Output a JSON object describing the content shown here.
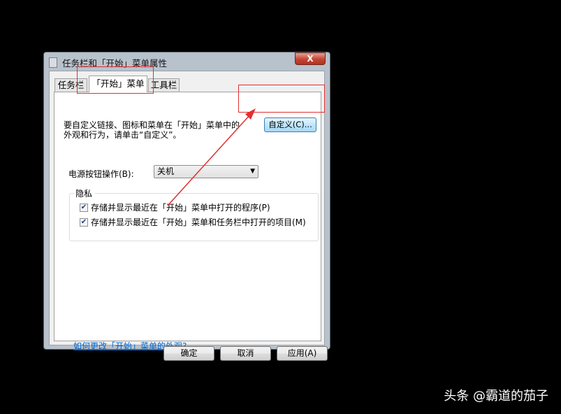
{
  "window": {
    "title": "任务栏和「开始」菜单属性",
    "close_label": "X"
  },
  "tabs": [
    {
      "label": "任务栏",
      "selected": false
    },
    {
      "label": "「开始」菜单",
      "selected": true
    },
    {
      "label": "工具栏",
      "selected": false
    }
  ],
  "start_menu": {
    "description": "要自定义链接、图标和菜单在「开始」菜单中的外观和行为，请单击“自定义”。",
    "customize_label": "自定义(C)...",
    "power_button_label": "电源按钮操作(B):",
    "power_button_value": "关机",
    "privacy": {
      "title": "隐私",
      "items": [
        {
          "label": "存储并显示最近在「开始」菜单中打开的程序(P)",
          "checked": true
        },
        {
          "label": "存储并显示最近在「开始」菜单和任务栏中打开的项目(M)",
          "checked": true
        }
      ]
    },
    "help_link": "如何更改「开始」菜单的外观?"
  },
  "buttons": {
    "ok": "确定",
    "cancel": "取消",
    "apply": "应用(A)"
  },
  "watermark": "头条 @霸道的茄子",
  "colors": {
    "annotation": "#e03030",
    "link": "#0066cc"
  }
}
